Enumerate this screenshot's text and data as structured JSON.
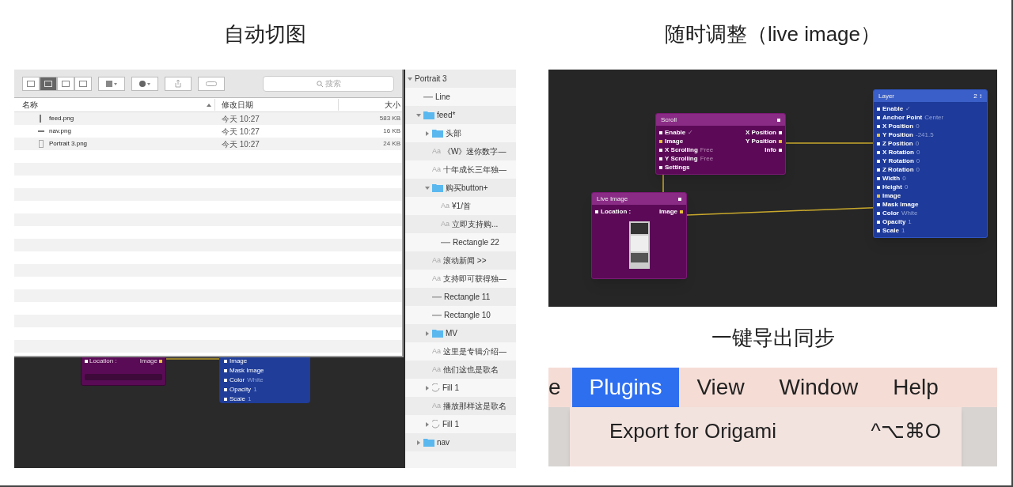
{
  "left_panel": {
    "title": "自动切图",
    "finder": {
      "search_placeholder": "搜索",
      "view_buttons": [
        {
          "selected": false
        },
        {
          "selected": true
        },
        {
          "selected": false
        },
        {
          "selected": false
        }
      ],
      "columns": [
        "名称",
        "修改日期",
        "大小"
      ],
      "rows": [
        {
          "kind": "tall",
          "name": "feed.png",
          "modified": "今天 10:27",
          "size": "583 KB"
        },
        {
          "kind": "wide",
          "name": "nav.png",
          "modified": "今天 10:27",
          "size": "16 KB"
        },
        {
          "kind": "page",
          "name": "Portrait 3.png",
          "modified": "今天 10:27",
          "size": "24 KB"
        }
      ]
    },
    "canvas_fragments": {
      "purple": {
        "input": "Location :",
        "output": "Image"
      },
      "blue": [
        {
          "label": "Image"
        },
        {
          "label": "Mask Image"
        },
        {
          "label": "Color",
          "value": "White"
        },
        {
          "label": "Opacity",
          "value": "1"
        },
        {
          "label": "Scale",
          "value": "1"
        }
      ]
    },
    "layers": [
      {
        "label": "Portrait 3",
        "expanded": true,
        "children": [
          {
            "kind": "line",
            "label": "Line"
          },
          {
            "kind": "folder",
            "label": "feed*",
            "expanded": true,
            "children": [
              {
                "kind": "folder",
                "label": "头部",
                "expanded": false
              },
              {
                "kind": "text",
                "glyph": "Aa",
                "label": "《W》迷你数字—"
              },
              {
                "kind": "text",
                "glyph": "Aa",
                "label": "十年成长三年独—"
              },
              {
                "kind": "folder",
                "label": "购买button+",
                "expanded": true,
                "children": [
                  {
                    "kind": "text",
                    "glyph": "Aa",
                    "label": "¥1/首"
                  },
                  {
                    "kind": "text",
                    "glyph": "Aa",
                    "label": "立即支持购..."
                  },
                  {
                    "kind": "line",
                    "label": "Rectangle 22"
                  }
                ]
              },
              {
                "kind": "text",
                "glyph": "Aa",
                "label": "滚动新闻 >>"
              },
              {
                "kind": "text",
                "glyph": "Aa",
                "label": "支持即可获得独—"
              },
              {
                "kind": "line",
                "label": "Rectangle 11"
              },
              {
                "kind": "line",
                "label": "Rectangle 10"
              },
              {
                "kind": "folder",
                "label": "MV",
                "expanded": false
              },
              {
                "kind": "text",
                "glyph": "Aa",
                "label": "这里是专辑介绍—"
              },
              {
                "kind": "text",
                "glyph": "Aa",
                "label": "他们这也是歌名"
              },
              {
                "kind": "fill",
                "label": "Fill 1",
                "expanded": false
              },
              {
                "kind": "text",
                "glyph": "Aa",
                "label": "播放那样这是歌名"
              },
              {
                "kind": "fill",
                "label": "Fill 1",
                "expanded": false
              }
            ]
          },
          {
            "kind": "folder",
            "label": "nav",
            "expanded": false
          }
        ]
      }
    ]
  },
  "right_top": {
    "title": "随时调整（live image）",
    "nodes": [
      {
        "kind": "scroll",
        "title": "Scroll",
        "inputs": [
          {
            "label": "Enable",
            "value": "✓",
            "connected": false
          },
          {
            "label": "Image",
            "connected": true
          },
          {
            "label": "X Scrolling",
            "value": "Free",
            "connected": false
          },
          {
            "label": "Y Scrolling",
            "value": "Free",
            "connected": false
          },
          {
            "label": "Settings",
            "connected": false
          }
        ],
        "outputs": [
          {
            "label": "X Position",
            "connected": false
          },
          {
            "label": "Y Position",
            "connected": true
          },
          {
            "label": "Info",
            "connected": false
          }
        ]
      },
      {
        "kind": "live",
        "title": "Live Image",
        "inputs": [
          {
            "label": "Location :",
            "connected": false
          }
        ],
        "outputs": [
          {
            "label": "Image",
            "connected": true
          }
        ]
      },
      {
        "kind": "layer",
        "title": "Layer",
        "badge": "2 ↕",
        "inputs": [
          {
            "label": "Enable",
            "value": "✓",
            "connected": false
          },
          {
            "label": "Anchor Point",
            "value": "Center",
            "connected": false
          },
          {
            "label": "X Position",
            "value": "0",
            "connected": false
          },
          {
            "label": "Y Position",
            "value": "-241.5",
            "connected": true
          },
          {
            "label": "Z Position",
            "value": "0",
            "connected": false
          },
          {
            "label": "X Rotation",
            "value": "0",
            "connected": false
          },
          {
            "label": "Y Rotation",
            "value": "0",
            "connected": false
          },
          {
            "label": "Z Rotation",
            "value": "0",
            "connected": false
          },
          {
            "label": "Width",
            "value": "0",
            "connected": false
          },
          {
            "label": "Height",
            "value": "0",
            "connected": false
          },
          {
            "label": "Image",
            "connected": true
          },
          {
            "label": "Mask Image",
            "connected": false
          },
          {
            "label": "Color",
            "value": "White",
            "connected": false
          },
          {
            "label": "Opacity",
            "value": "1",
            "connected": false
          },
          {
            "label": "Scale",
            "value": "1",
            "connected": false
          }
        ]
      }
    ]
  },
  "right_bottom": {
    "title": "一键导出同步",
    "menu_bar": [
      {
        "label": "e",
        "selected": false
      },
      {
        "label": "Plugins",
        "selected": true
      },
      {
        "label": "View",
        "selected": false
      },
      {
        "label": "Window",
        "selected": false
      },
      {
        "label": "Help",
        "selected": false
      }
    ],
    "menu_item": {
      "label": "Export for Origami",
      "shortcut": "^⌥⌘O"
    }
  }
}
